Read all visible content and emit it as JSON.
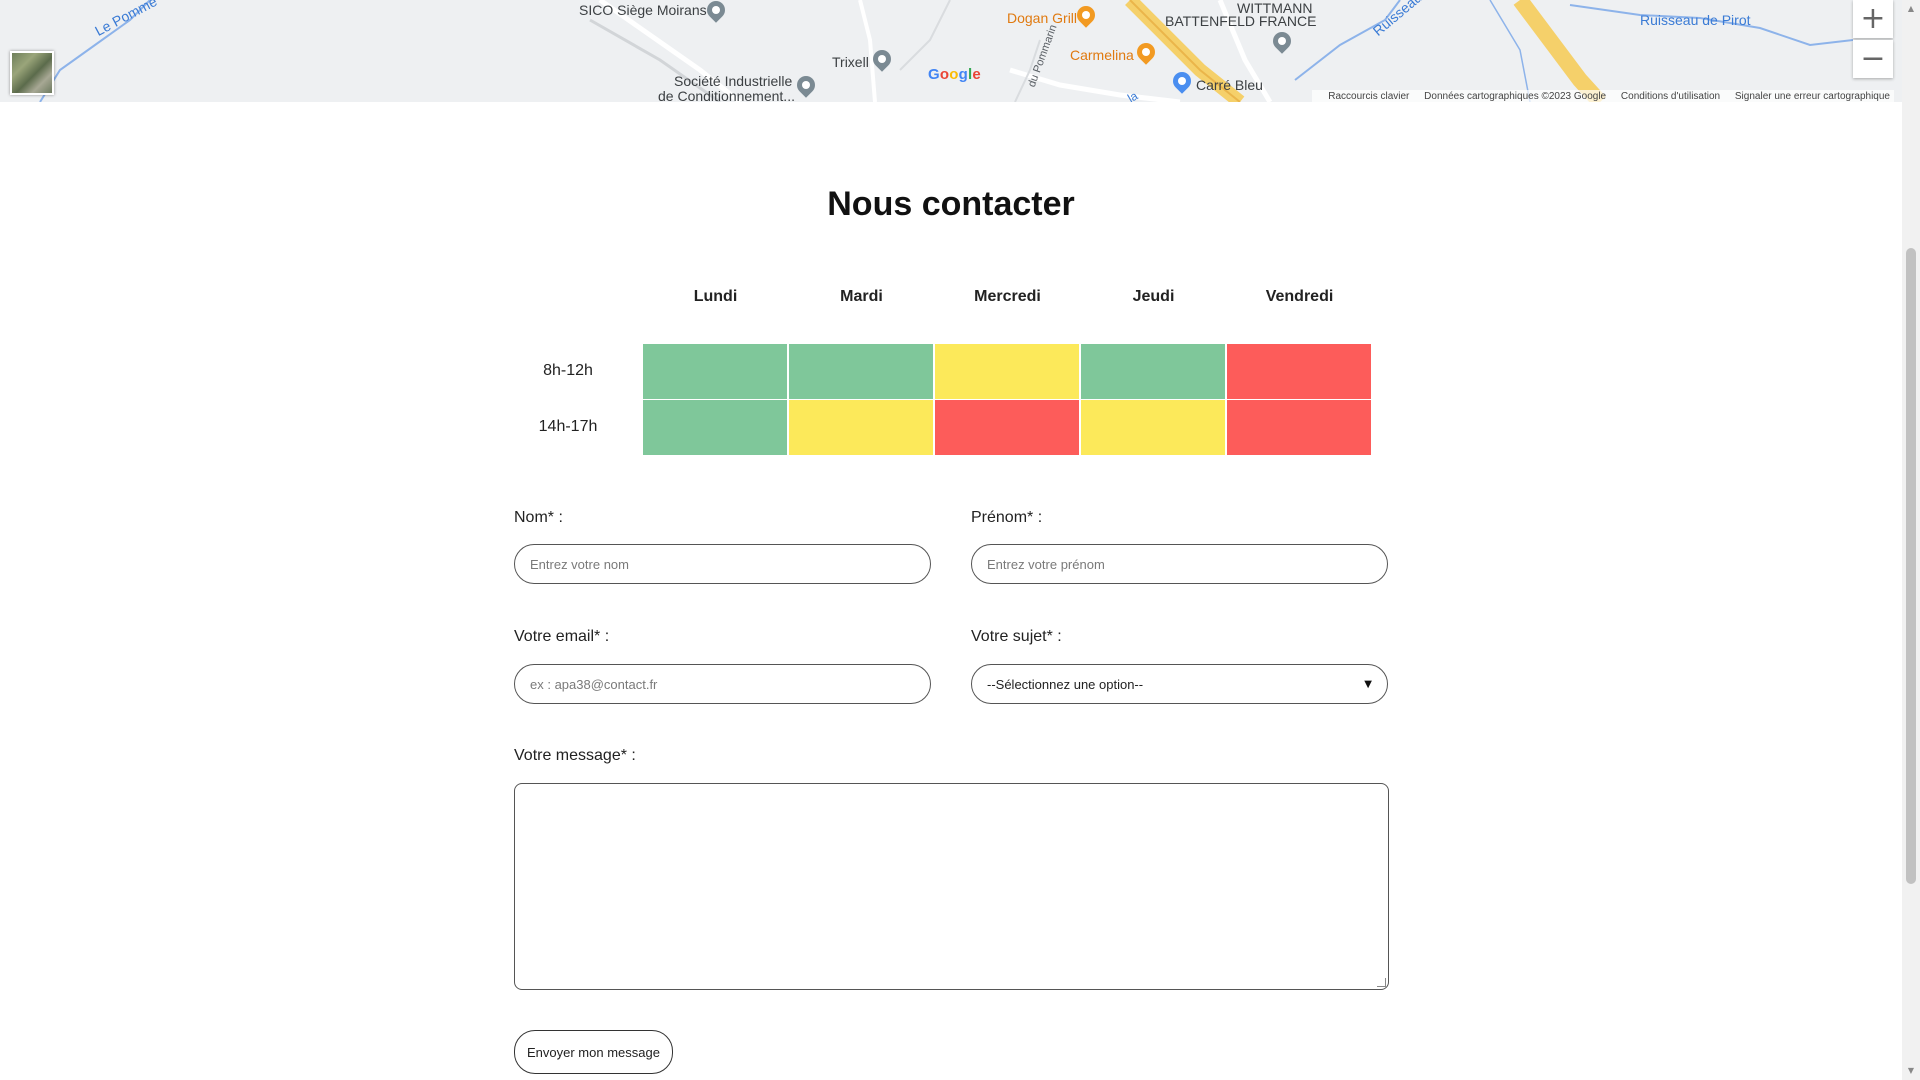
{
  "map": {
    "labels": {
      "sico": "SICO Siège Moirans",
      "societe_line1": "Société Industrielle",
      "societe_line2": "de Conditionnement...",
      "trixell": "Trixell",
      "dogan": "Dogan Grill",
      "carmelina": "Carmelina",
      "wittmann_line1": "WITTMANN",
      "wittmann_line2": "BATTENFELD FRANCE",
      "carre_bleu": "Carré Bleu",
      "le_pomme": "Le Pomme",
      "ruisseau": "Ruisseau",
      "ruisseau_pirot": "Ruisseau de Pirot",
      "du_pommarin": "du Pommarin",
      "road_la": "la"
    },
    "google_logo": "Google",
    "zoom_in": "+",
    "zoom_out": "−",
    "attribution": {
      "shortcuts": "Raccourcis clavier",
      "data": "Données cartographiques ©2023 Google",
      "terms": "Conditions d'utilisation",
      "report": "Signaler une erreur cartographique"
    },
    "colors": {
      "background": "#eef0f2",
      "water": "#3a7bd5",
      "highway": "#f5d06a"
    }
  },
  "contact": {
    "title": "Nous contacter",
    "schedule": {
      "days": [
        "Lundi",
        "Mardi",
        "Mercredi",
        "Jeudi",
        "Vendredi"
      ],
      "rows": [
        {
          "label": "8h-12h",
          "status": [
            "green",
            "green",
            "yellow",
            "green",
            "red"
          ]
        },
        {
          "label": "14h-17h",
          "status": [
            "green",
            "yellow",
            "red",
            "yellow",
            "red"
          ]
        }
      ],
      "colors": {
        "green": "#7fc79a",
        "yellow": "#fce95a",
        "red": "#fd5c5a"
      }
    },
    "form": {
      "nom_label": "Nom* :",
      "nom_placeholder": "Entrez votre nom",
      "prenom_label": "Prénom* :",
      "prenom_placeholder": "Entrez votre prénom",
      "email_label": "Votre email* :",
      "email_placeholder": "ex : apa38@contact.fr",
      "sujet_label": "Votre sujet* :",
      "sujet_selected": "--Sélectionnez une option--",
      "message_label": "Votre message* :",
      "submit_label": "Envoyer mon message"
    }
  }
}
